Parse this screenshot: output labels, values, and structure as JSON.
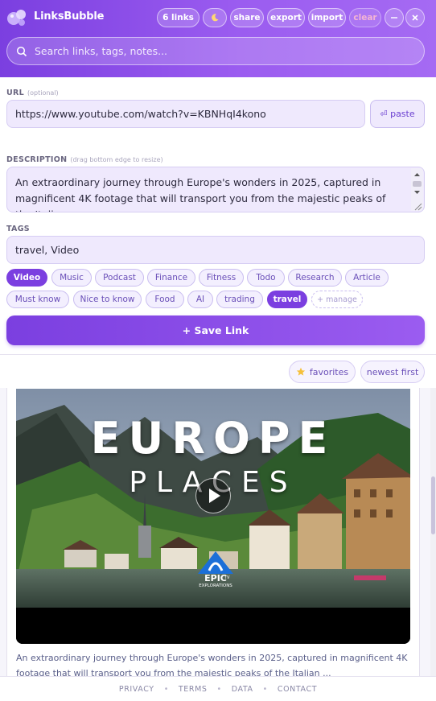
{
  "app": {
    "title": "LinksBubble"
  },
  "header": {
    "links_count": "6 links",
    "buttons": {
      "share": "share",
      "export": "export",
      "import": "import",
      "clear": "clear"
    },
    "theme_icon": "moon-icon",
    "minimize_icon": "minimize-icon",
    "close_icon": "close-icon"
  },
  "search": {
    "placeholder": "Search links, tags, notes..."
  },
  "form": {
    "url_label": "URL",
    "url_hint": "(optional)",
    "url_value": "https://www.youtube.com/watch?v=KBNHqI4kono",
    "paste_label": "⏎ paste",
    "description_label": "DESCRIPTION",
    "description_hint": "(drag bottom edge to resize)",
    "description_value": "An extraordinary journey through Europe's wonders in 2025, captured in magnificent 4K footage that will transport you from the majestic peaks of the Italian",
    "tags_label": "TAGS",
    "tags_value": "travel, Video",
    "save_label": "+ Save Link"
  },
  "tags": [
    {
      "label": "Video",
      "active": true
    },
    {
      "label": "Music",
      "active": false
    },
    {
      "label": "Podcast",
      "active": false
    },
    {
      "label": "Finance",
      "active": false
    },
    {
      "label": "Fitness",
      "active": false
    },
    {
      "label": "Todo",
      "active": false
    },
    {
      "label": "Research",
      "active": false
    },
    {
      "label": "Article",
      "active": false
    },
    {
      "label": "Must know",
      "active": false
    },
    {
      "label": "Nice to know",
      "active": false
    },
    {
      "label": "Food",
      "active": false
    },
    {
      "label": "AI",
      "active": false
    },
    {
      "label": "trading",
      "active": false
    },
    {
      "label": "travel",
      "active": true
    },
    {
      "label": "+ manage",
      "active": false
    }
  ],
  "filters": {
    "favorites": "favorites",
    "sort": "newest first"
  },
  "card": {
    "thumbnail": {
      "title_line1": "EUROPE",
      "title_line2": "PLACES",
      "badge_line1": "EPIC",
      "badge_line2": "EXPLORATIONS",
      "badge_tv": "TV"
    },
    "description": "An extraordinary journey through Europe's wonders in 2025, captured in magnificent 4K footage that will transport you from the majestic peaks of the Italian ..."
  },
  "footer": {
    "links": [
      "PRIVACY",
      "TERMS",
      "DATA",
      "CONTACT"
    ]
  },
  "colors": {
    "accent": "#7b3fe0",
    "accent_light": "#9b5cf0",
    "field_bg": "#efe9fd"
  }
}
